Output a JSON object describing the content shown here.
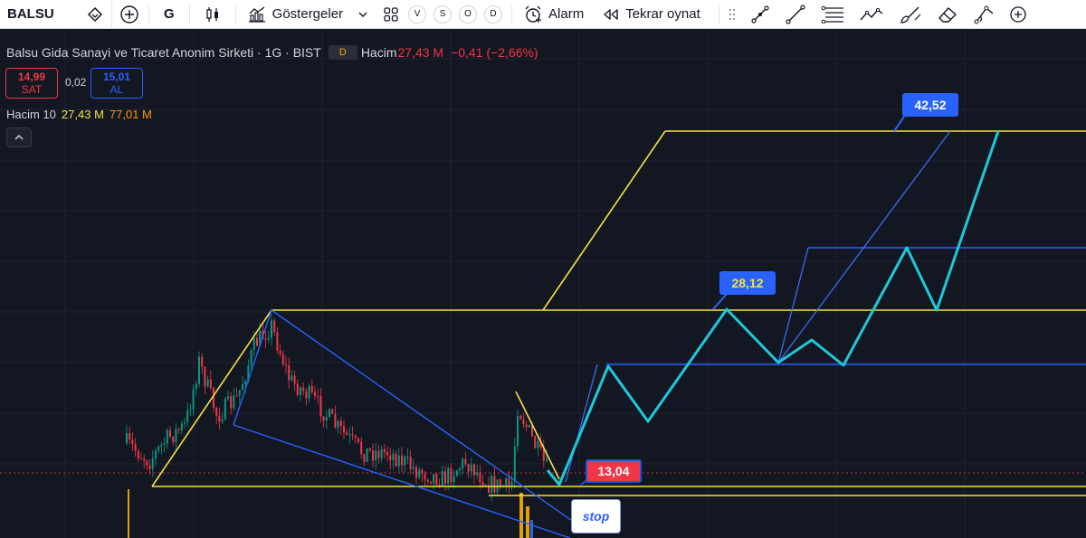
{
  "toolbar": {
    "symbol": "BALSU",
    "interval": "G",
    "indicators_label": "Göstergeler",
    "layout_letters": [
      "V",
      "S",
      "O",
      "D"
    ],
    "alarm_label": "Alarm",
    "replay_label": "Tekrar oynat",
    "icons": [
      "diamond-icon",
      "plus-circle-icon",
      "candles-icon",
      "indicators-icon",
      "chevron-down-icon",
      "templates-icon",
      "alarm-clock-icon",
      "replay-icon",
      "drag-handle-icon",
      "trend-line-icon",
      "line-icon",
      "fib-lines-icon",
      "pattern-icon",
      "brush-icon",
      "eraser-icon",
      "measure-icon",
      "more-icon"
    ]
  },
  "legend": {
    "title": "Balsu Gida Sanayi ve Ticaret Anonim Sirketi · 1G · BIST",
    "badge": "D",
    "volume_label": "Hacim",
    "volume_value": "27,43 M",
    "change": "−0,41 (−2,66%)",
    "sell_price": "14,99",
    "sell_label": "SAT",
    "spread": "0,02",
    "buy_price": "15,01",
    "buy_label": "AL",
    "vol10_label": "Hacim 10",
    "vol10_value1": "27,43 M",
    "vol10_value2": "77,01 M"
  },
  "callouts": {
    "target_high": "42,52",
    "target_mid": "28,12",
    "entry": "13,04",
    "stop": "stop"
  },
  "colors": {
    "chart_bg": "#131722",
    "yellow": "#f5e142",
    "blue": "#2962ff",
    "light_blue": "#3b6cf5",
    "cyan": "#1ec8d8",
    "red": "#f23645",
    "green": "#089981",
    "orange": "#ff9800"
  }
}
